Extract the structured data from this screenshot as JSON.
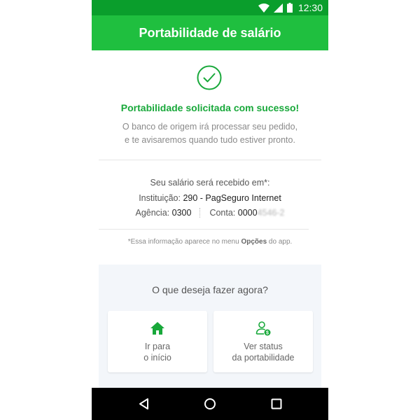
{
  "status_bar": {
    "time": "12:30",
    "icons": [
      "wifi-icon",
      "signal-icon",
      "battery-icon"
    ]
  },
  "app_bar": {
    "title": "Portabilidade de salário"
  },
  "success": {
    "icon": "check-circle-icon",
    "title": "Portabilidade solicitada com sucesso!",
    "description_line1": "O banco de origem irá processar seu pedido,",
    "description_line2": "e te avisaremos quando tudo estiver pronto."
  },
  "receive": {
    "title": "Seu salário será recebido em*:",
    "institution_label": "Instituição:",
    "institution_value": "290 - PagSeguro Internet",
    "agency_label": "Agência:",
    "agency_value": "0300",
    "account_label": "Conta:",
    "account_value_visible": "0000",
    "account_value_blurred": "4546-2"
  },
  "note": {
    "prefix": "*Essa informação aparece no menu ",
    "bold": "Opções",
    "suffix": " do app."
  },
  "actions": {
    "title": "O que deseja fazer agora?",
    "home_line1": "Ir para",
    "home_line2": "o início",
    "status_line1": "Ver status",
    "status_line2": "da portabilidade"
  },
  "nav_bar": {
    "buttons": [
      "back-icon",
      "home-circle-icon",
      "recent-apps-icon"
    ]
  },
  "colors": {
    "status_bar": "#0a9e2c",
    "app_bar": "#1fbf3f",
    "accent_green": "#18a83a",
    "panel_bg": "#f3f6fa"
  }
}
